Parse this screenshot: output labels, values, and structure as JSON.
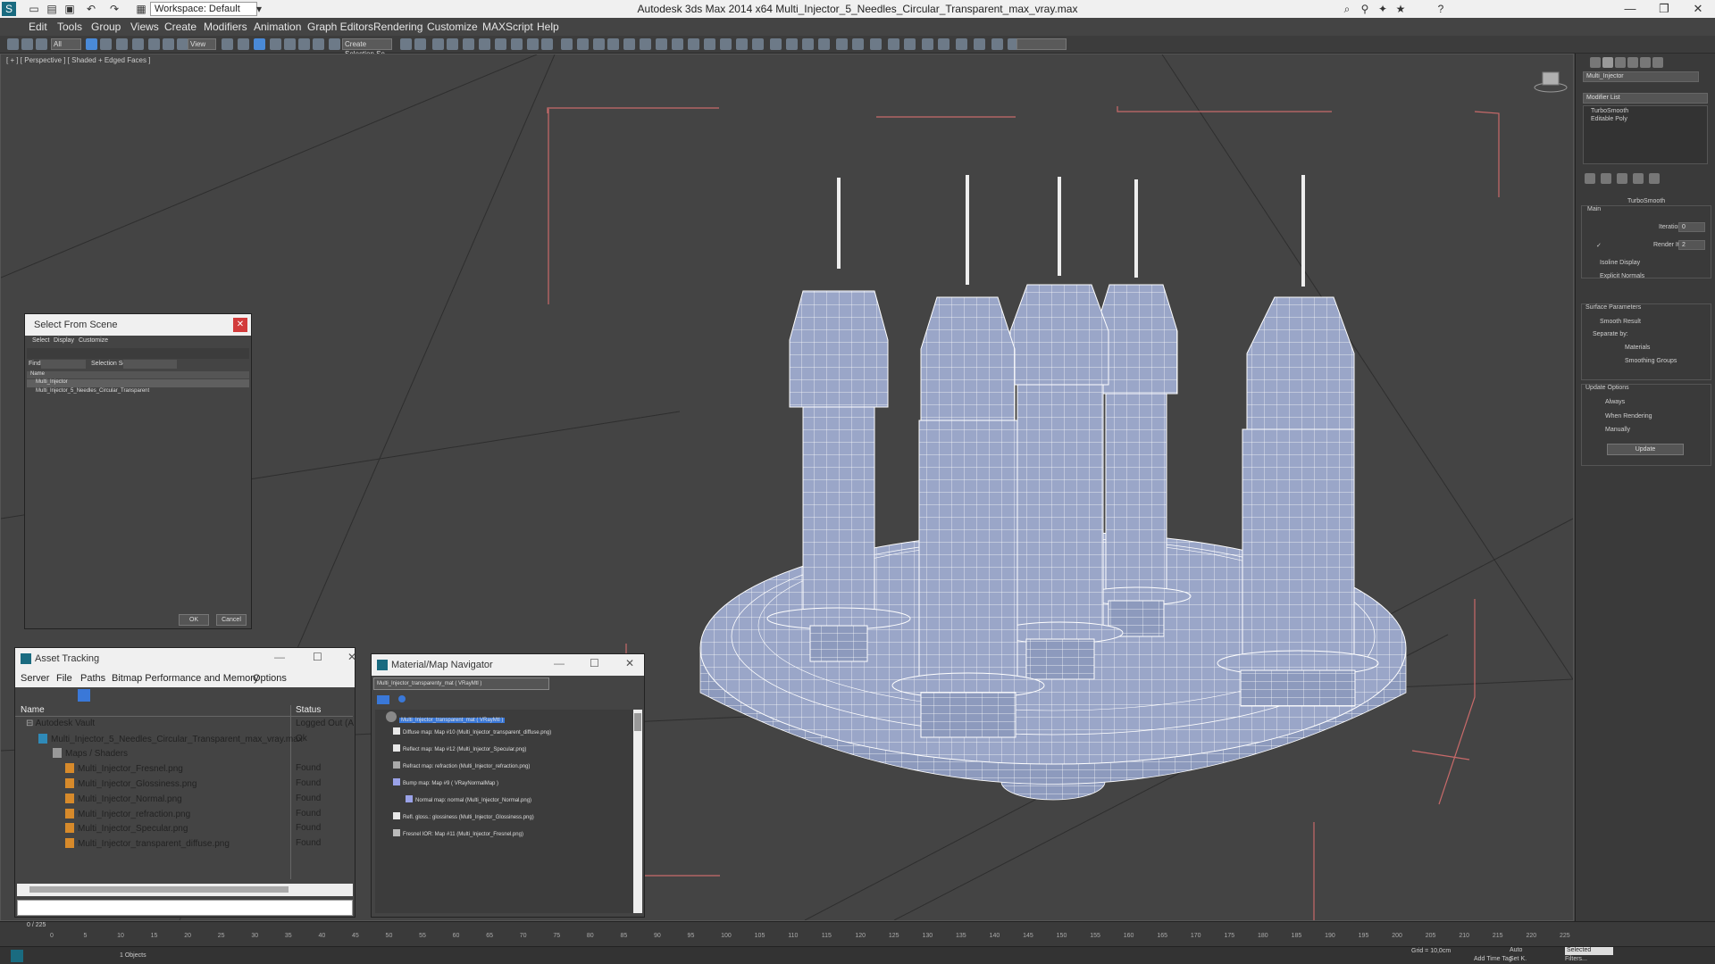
{
  "app": {
    "title": "Autodesk 3ds Max  2014 x64     Multi_Injector_5_Needles_Circular_Transparent_max_vray.max",
    "workspace": "Workspace: Default"
  },
  "menu": [
    "Edit",
    "Tools",
    "Group",
    "Views",
    "Create",
    "Modifiers",
    "Animation",
    "Graph Editors",
    "Rendering",
    "Customize",
    "MAXScript",
    "Help"
  ],
  "toolbar": {
    "selection_filter": "All",
    "ref_coord": "View",
    "named_selection": "Create Selection Se"
  },
  "viewport": {
    "label": "[ + ] [ Perspective ] [ Shaded + Edged Faces ]"
  },
  "select_from_scene": {
    "title": "Select From Scene",
    "menu": [
      "Select",
      "Display",
      "Customize"
    ],
    "find_label": "Find:",
    "selection_set": "Selection Set:",
    "column": "Name",
    "items": [
      "Multi_Injector",
      "Multi_Injector_5_Needles_Circular_Transparent"
    ],
    "ok": "OK",
    "cancel": "Cancel"
  },
  "asset_tracking": {
    "title": "Asset Tracking",
    "menu": [
      "Server",
      "File",
      "Paths",
      "Bitmap Performance and Memory",
      "Options"
    ],
    "col_name": "Name",
    "col_status": "Status",
    "rows": [
      {
        "name": "Autodesk Vault",
        "status": "Logged Out (A"
      },
      {
        "name": "Multi_Injector_5_Needles_Circular_Transparent_max_vray.max",
        "status": "Ok"
      },
      {
        "name": "Maps / Shaders",
        "status": ""
      },
      {
        "name": "Multi_Injector_Fresnel.png",
        "status": "Found"
      },
      {
        "name": "Multi_Injector_Glossiness.png",
        "status": "Found"
      },
      {
        "name": "Multi_Injector_Normal.png",
        "status": "Found"
      },
      {
        "name": "Multi_Injector_refraction.png",
        "status": "Found"
      },
      {
        "name": "Multi_Injector_Specular.png",
        "status": "Found"
      },
      {
        "name": "Multi_Injector_transparent_diffuse.png",
        "status": "Found"
      }
    ]
  },
  "material_navigator": {
    "title": "Material/Map Navigator",
    "field": "Multi_Injector_transparenty_mat  ( VRayMtl )",
    "root": "Multi_Injector_transparent_mat  ( VRayMtl )",
    "items": [
      "Diffuse map: Map #10 (Multi_Injector_transparent_diffuse.png)",
      "Reflect map: Map #12 (Multi_Injector_Specular.png)",
      "Refract map: refraction (Multi_Injector_refraction.png)",
      "Bump map: Map #9  ( VRayNormalMap )",
      "Normal map: normal (Multi_Injector_Normal.png)",
      "Refl. gloss.: glossiness (Multi_Injector_Glossiness.png)",
      "Fresnel IOR: Map #11 (Multi_Injector_Fresnel.png)"
    ]
  },
  "command_panel": {
    "object_name": "Multi_Injector",
    "modifier_list": "Modifier List",
    "stack": [
      "TurboSmooth",
      "Editable Poly"
    ],
    "rollout_title": "TurboSmooth",
    "main": "Main",
    "iterations": "Iterations:",
    "iterations_val": "0",
    "render_iters": "Render Iters:",
    "render_iters_val": "2",
    "isoline": "Isoline Display",
    "explicit": "Explicit Normals",
    "surface_params": "Surface Parameters",
    "smooth_result": "Smooth Result",
    "separate_by": "Separate by:",
    "materials": "Materials",
    "smoothing_groups": "Smoothing Groups",
    "update_options": "Update Options",
    "always": "Always",
    "when_rendering": "When Rendering",
    "manually": "Manually",
    "update": "Update"
  },
  "timeline": {
    "frame": "0 / 225",
    "ticks": [
      "0",
      "5",
      "10",
      "15",
      "20",
      "25",
      "30",
      "35",
      "40",
      "45",
      "50",
      "55",
      "60",
      "65",
      "70",
      "75",
      "80",
      "85",
      "90",
      "95",
      "100",
      "105",
      "110",
      "115",
      "120",
      "125",
      "130",
      "135",
      "140",
      "145",
      "150",
      "155",
      "160",
      "165",
      "170",
      "175",
      "180",
      "185",
      "190",
      "195",
      "200",
      "205",
      "210",
      "215",
      "220",
      "225"
    ]
  },
  "status": {
    "objects": "1 Objects",
    "grid": "Grid = 10,0cm",
    "auto": "Auto",
    "selected": "Selected",
    "add_time_tag": "Add Time Tag",
    "set_k": "Set K.",
    "filters": "Filters..."
  },
  "colors": {
    "viewport_bg": "#444444",
    "mesh": "#9aa6c8",
    "wire": "#ffffff",
    "selection": "#3a78d8"
  }
}
